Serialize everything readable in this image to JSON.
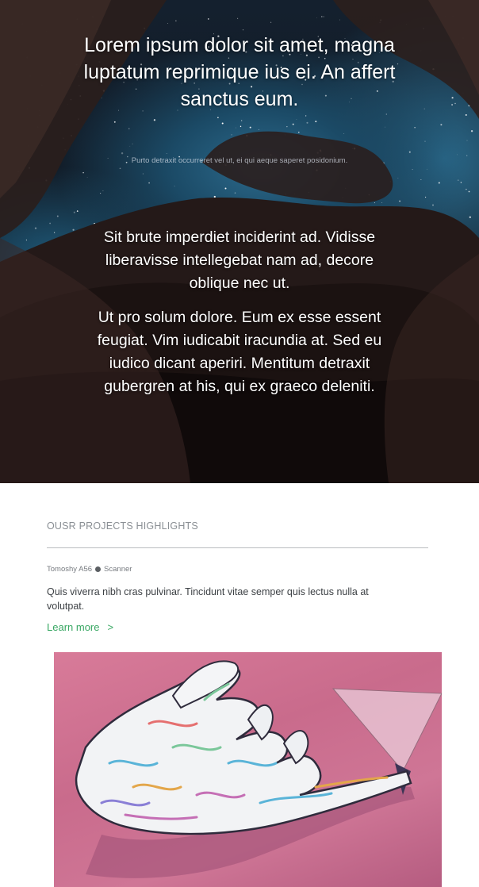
{
  "hero": {
    "title": "Lorem ipsum dolor sit amet, magna luptatum reprimique ius ei. An affert sanctus eum.",
    "subtitle": "Purto detraxit occurreret vel ut, ei qui aeque saperet posidonium.",
    "paragraph1": "Sit brute imperdiet inciderint ad. Vidisse liberavisse intellegebat nam ad, decore oblique nec ut.",
    "paragraph2": "Ut pro solum dolore. Eum ex esse essent feugiat. Vim iudicabit iracundia at. Sed eu iudico dicant aperiri. Mentitum detraxit gubergren at his, qui ex graeco deleniti."
  },
  "projects": {
    "section_title": "OUSR PROJECTS HIGHLIGHTS",
    "item": {
      "author": "Tomoshy A56",
      "category": "Scanner",
      "description": "Quis viverra nibh cras pulvinar. Tincidunt vitae semper quis lectus nulla at volutpat.",
      "link_label": "Learn more",
      "link_icon": ">"
    }
  },
  "colors": {
    "accent_link": "#3aa864",
    "artwork_background": "#d87b99",
    "hero_sky": "#1b4a66"
  }
}
